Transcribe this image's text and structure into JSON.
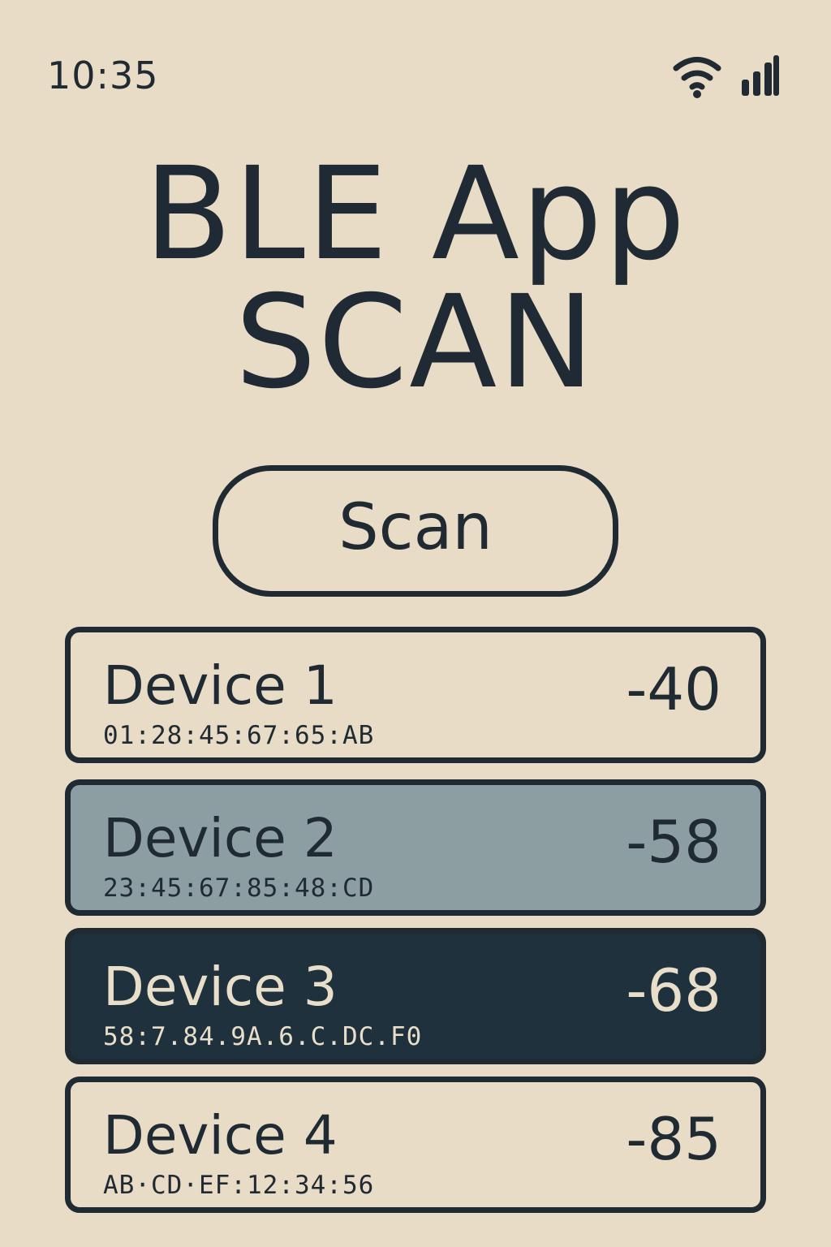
{
  "status_bar": {
    "time": "10:35",
    "wifi_icon": "wifi-icon",
    "signal_icon": "signal-icon"
  },
  "header": {
    "title_line_1": "BLE App",
    "title_line_2": "SCAN"
  },
  "scan_button": {
    "label": "Scan"
  },
  "devices": [
    {
      "name": "Device 1",
      "address": "01:28:45:67:65:AB",
      "rssi": "-40",
      "state_color": "#e9dcc6"
    },
    {
      "name": "Device 2",
      "address": "23:45:67:85:48:CD",
      "rssi": "-58",
      "state_color": "#8d9ea3"
    },
    {
      "name": "Device 3",
      "address": "58:7.84.9A.6.C.DC.F0",
      "rssi": "-68",
      "state_color": "#1f313d"
    },
    {
      "name": "Device 4",
      "address": "AB·CD·EF:12:34:56",
      "rssi": "-85",
      "state_color": "#e9dcc6"
    }
  ],
  "colors": {
    "background": "#e9dcc6",
    "ink": "#1f2a33",
    "selected_light": "#8d9ea3",
    "selected_dark": "#1f313d",
    "selected_dark_text": "#e8dec9"
  }
}
